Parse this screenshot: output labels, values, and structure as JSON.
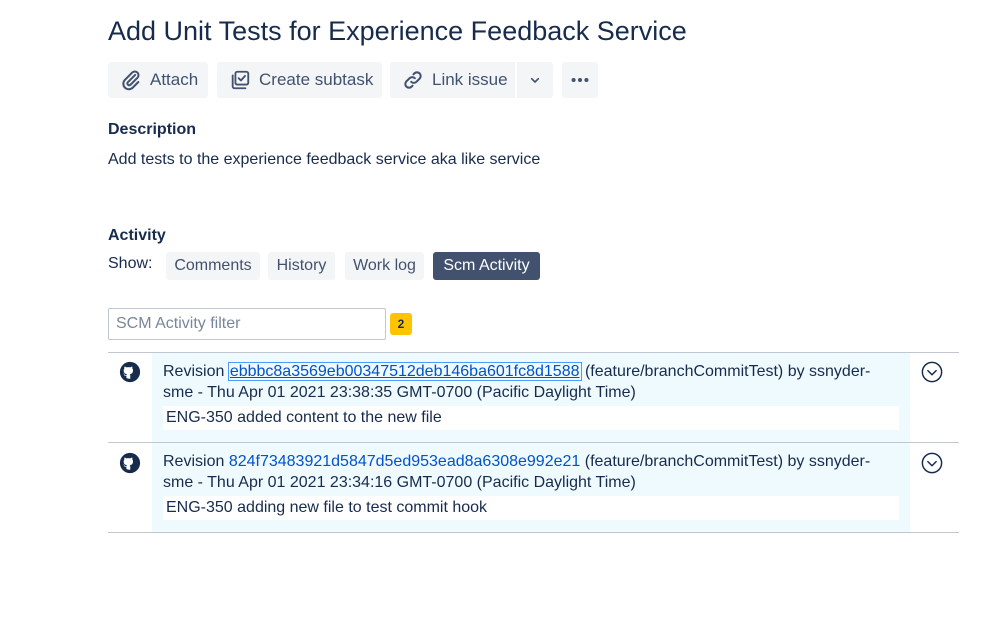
{
  "issue": {
    "title": "Add Unit Tests for Experience Feedback Service"
  },
  "toolbar": {
    "attach_label": "Attach",
    "create_subtask_label": "Create subtask",
    "link_issue_label": "Link issue"
  },
  "description": {
    "heading": "Description",
    "text": "Add tests to the experience feedback service aka like service"
  },
  "activity": {
    "heading": "Activity",
    "show_label": "Show:",
    "tabs": [
      {
        "label": "Comments",
        "active": false
      },
      {
        "label": "History",
        "active": false
      },
      {
        "label": "Work log",
        "active": false
      },
      {
        "label": "Scm Activity",
        "active": true
      }
    ],
    "filter_placeholder": "SCM Activity filter",
    "filter_value": "",
    "count": "2"
  },
  "commits": [
    {
      "revision_prefix": "Revision",
      "hash": "ebbbc8a3569eb00347512deb146ba601fc8d1588",
      "branch_info": "(feature/branchCommitTest) by ssnyder-sme - Thu Apr 01 2021 23:38:35 GMT-0700 (Pacific Daylight Time)",
      "message": "ENG-350 added content to the new file"
    },
    {
      "revision_prefix": "Revision",
      "hash": "824f73483921d5847d5ed953ead8a6308e992e21",
      "branch_info": "(feature/branchCommitTest) by ssnyder-sme - Thu Apr 01 2021 23:34:16 GMT-0700 (Pacific Daylight Time)",
      "message": "ENG-350 adding new file to test commit hook"
    }
  ],
  "icons": {
    "attach": "paperclip-icon",
    "create_subtask": "subtask-icon",
    "link_issue": "link-icon",
    "dropdown": "chevron-down-icon",
    "more": "more-icon",
    "commit_source": "github-icon",
    "expand": "chevron-circle-icon"
  },
  "colors": {
    "title": "#172B4D",
    "active_tab": "#42526E",
    "link": "#0052CC",
    "count_badge": "#FFC400",
    "entry_background": "#EFFAFF"
  }
}
